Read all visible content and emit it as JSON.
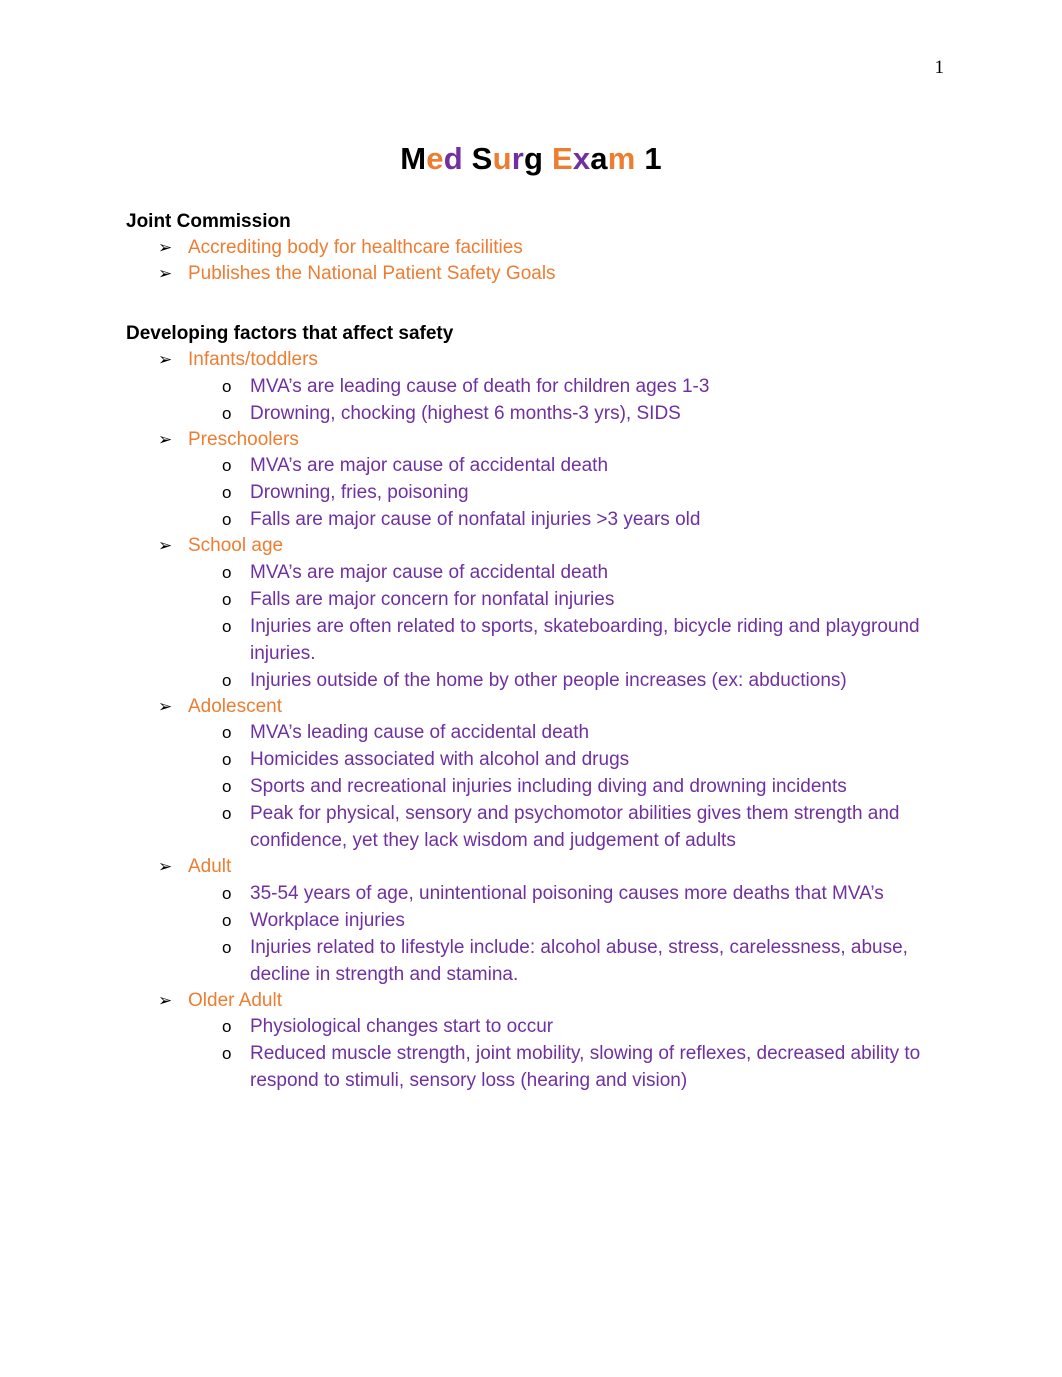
{
  "page": {
    "number": "1",
    "background_color": "#FFFFFF"
  },
  "colors": {
    "black": "#000000",
    "orange": "#ED7D31",
    "purple": "#7030A0"
  },
  "title": {
    "full_text": "Med Surg Exam 1",
    "letters": [
      {
        "char": "M",
        "color": "#000000"
      },
      {
        "char": "e",
        "color": "#ED7D31"
      },
      {
        "char": "d",
        "color": "#7030A0"
      },
      {
        "char": " ",
        "color": "#000000"
      },
      {
        "char": "S",
        "color": "#000000"
      },
      {
        "char": "u",
        "color": "#ED7D31"
      },
      {
        "char": "r",
        "color": "#7030A0"
      },
      {
        "char": "g",
        "color": "#000000"
      },
      {
        "char": " ",
        "color": "#000000"
      },
      {
        "char": "E",
        "color": "#ED7D31"
      },
      {
        "char": "x",
        "color": "#7030A0"
      },
      {
        "char": "a",
        "color": "#000000"
      },
      {
        "char": "m",
        "color": "#ED7D31"
      },
      {
        "char": " ",
        "color": "#000000"
      },
      {
        "char": "1",
        "color": "#000000"
      }
    ]
  },
  "markers": {
    "level1": "➢",
    "level2": "o"
  },
  "sections": [
    {
      "heading": "Joint Commission",
      "items": [
        {
          "text": "Accrediting body for healthcare facilities",
          "children": []
        },
        {
          "text": "Publishes the National Patient Safety Goals",
          "children": []
        }
      ]
    },
    {
      "heading": "Developing factors that affect safety",
      "items": [
        {
          "text": "Infants/toddlers",
          "children": [
            {
              "text": "MVA’s are leading cause of death for children ages 1-3"
            },
            {
              "text": "Drowning, chocking (highest 6 months-3 yrs), SIDS"
            }
          ]
        },
        {
          "text": "Preschoolers",
          "children": [
            {
              "text": "MVA’s are major cause of accidental death"
            },
            {
              "text": "Drowning, fries, poisoning"
            },
            {
              "text": "Falls are major cause of nonfatal injuries >3 years old"
            }
          ]
        },
        {
          "text": "School age",
          "children": [
            {
              "text": "MVA’s are major cause of accidental death"
            },
            {
              "text": "Falls are major concern for nonfatal injuries"
            },
            {
              "text": "Injuries are often related to sports, skateboarding, bicycle riding and playground injuries."
            },
            {
              "text": "Injuries outside of the home by other people increases (ex: abductions)"
            }
          ]
        },
        {
          "text": "Adolescent",
          "children": [
            {
              "text": "MVA’s leading cause of accidental death"
            },
            {
              "text": "Homicides associated with alcohol and drugs"
            },
            {
              "text": "Sports and recreational injuries including diving and drowning incidents"
            },
            {
              "text": "Peak for physical, sensory and psychomotor abilities gives them strength and confidence, yet they lack wisdom and judgement of adults"
            }
          ]
        },
        {
          "text": "Adult",
          "children": [
            {
              "text": "35-54 years of age, unintentional poisoning causes more deaths that MVA’s"
            },
            {
              "text": "Workplace injuries"
            },
            {
              "text": "Injuries related to lifestyle include: alcohol abuse, stress, carelessness, abuse, decline in strength and stamina."
            }
          ]
        },
        {
          "text": "Older Adult",
          "children": [
            {
              "text": "Physiological changes start to occur"
            },
            {
              "text": "Reduced muscle strength, joint mobility, slowing of reflexes, decreased ability to respond to stimuli, sensory loss (hearing and vision)"
            }
          ]
        }
      ]
    }
  ]
}
